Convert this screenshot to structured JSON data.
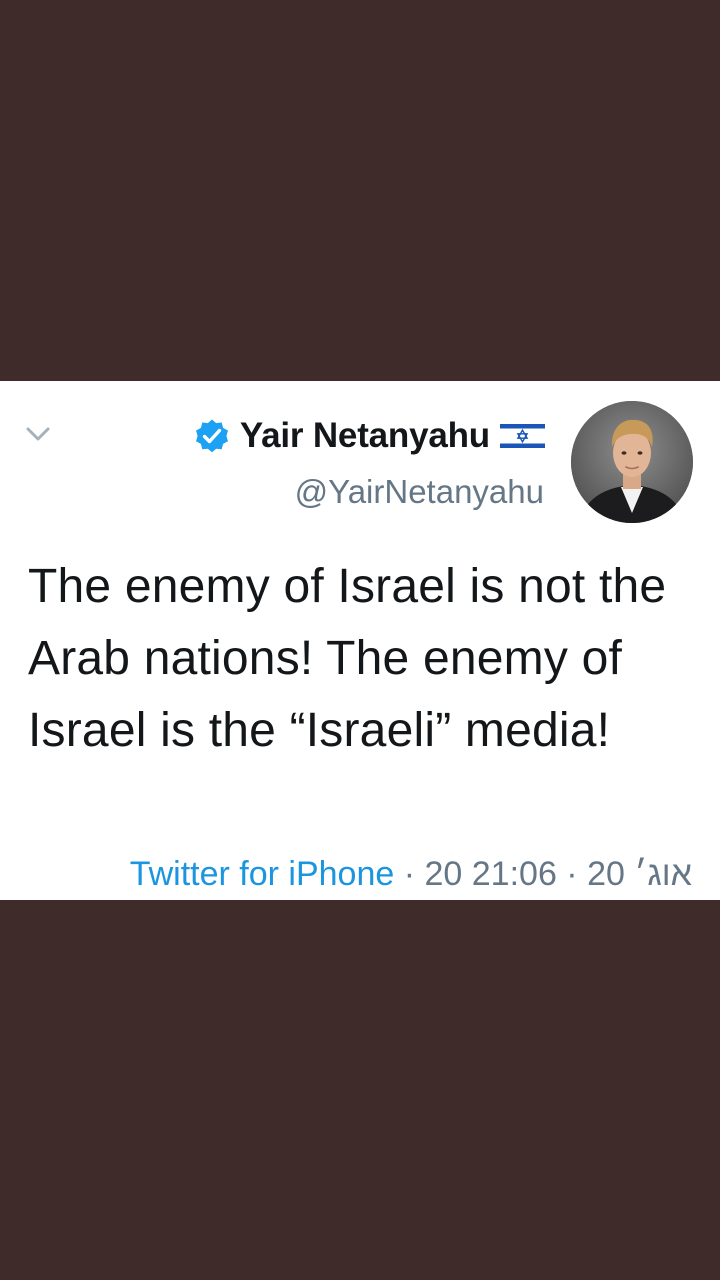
{
  "colors": {
    "background": "#3f2b2a",
    "card": "#ffffff",
    "text_primary": "#14171a",
    "text_secondary": "#657786",
    "link": "#1b95e0",
    "verified": "#1da1f2"
  },
  "tweet": {
    "display_name": "Yair Netanyahu",
    "handle": "@YairNetanyahu",
    "verified_icon": "verified-badge-icon",
    "flag_icon": "israel-flag-icon",
    "text": "The enemy of Israel is not the Arab nations! The enemy of Israel is the “Israeli” media!",
    "source": "Twitter for iPhone",
    "separator1": " · ",
    "date": "20 אוג׳ 20",
    "separator2": " · ",
    "time": "21:06"
  }
}
